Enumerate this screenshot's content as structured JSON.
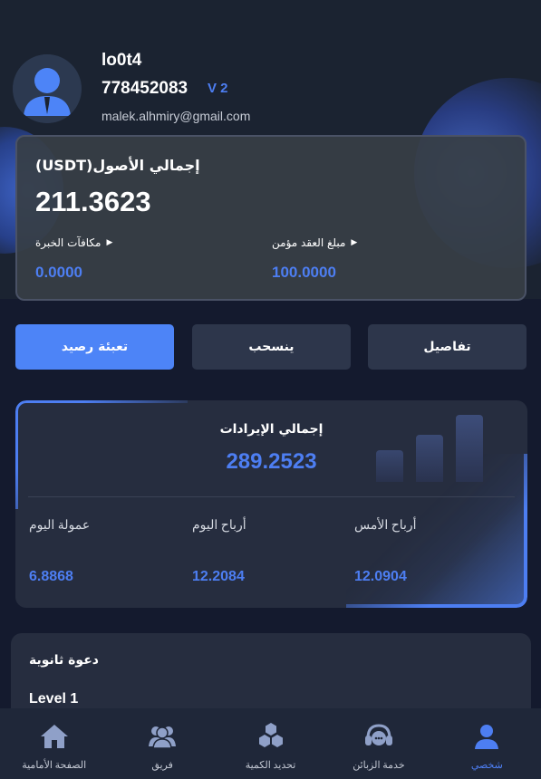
{
  "profile": {
    "username": "lo0t4",
    "uid": "778452083",
    "vip_level": "V 2",
    "email": "malek.alhmiry@gmail.com"
  },
  "assets": {
    "title": "إجمالي الأصول(USDT)",
    "total": "211.3623",
    "experience_reward_label": "مكافآت الخبرة",
    "experience_reward_value": "0.0000",
    "insured_amount_label": "مبلغ العقد مؤمن",
    "insured_amount_value": "100.0000"
  },
  "actions": {
    "recharge": "تعبئة رصيد",
    "withdraw": "ينسحب",
    "details": "تفاصيل"
  },
  "income": {
    "title": "إجمالي الإيرادات",
    "total": "289.2523",
    "today_commission_label": "عمولة اليوم",
    "today_commission_value": "6.8868",
    "today_profit_label": "أرباح اليوم",
    "today_profit_value": "12.2084",
    "yesterday_profit_label": "أرباح الأمس",
    "yesterday_profit_value": "12.0904"
  },
  "invite": {
    "title": "دعوة ثانوية",
    "level": "Level 1"
  },
  "nav": {
    "home": "الصفحة الأمامية",
    "team": "فريق",
    "quantify": "تحديد الكمية",
    "service": "خدمة الزبائن",
    "mine": "شخصي"
  },
  "colors": {
    "accent": "#4d7ef2",
    "background": "#141a2e",
    "card": "#262d3f"
  }
}
